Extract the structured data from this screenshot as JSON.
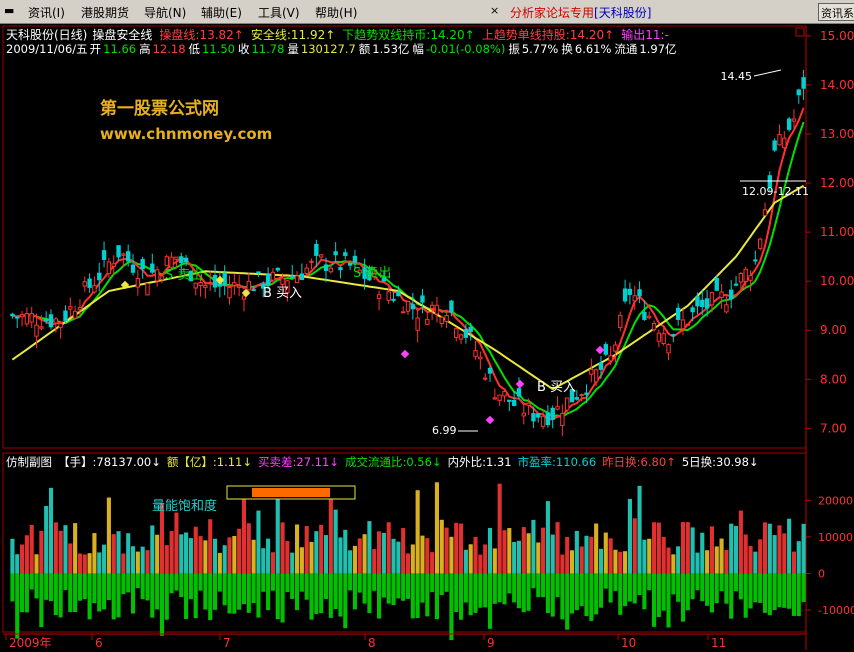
{
  "menu": {
    "items": [
      "资讯(I)",
      "港股期货",
      "导航(N)",
      "辅助(E)",
      "工具(V)",
      "帮助(H)"
    ],
    "ad_prefix": "分析家论坛专用",
    "ad_name": "[天科股份]",
    "right_button": "资讯系统",
    "min_icon": "minimize-icon",
    "close_icon": "close-icon"
  },
  "colors": {
    "up": "#ff3030",
    "down": "#00d0d0",
    "ma": "#e8e840",
    "vol_up": "#e03030",
    "vol_down": "#20c0b0"
  },
  "main": {
    "title": "天科股份(日线)",
    "indicator_name": "操盘安全线",
    "indicators": [
      {
        "label": "操盘线:",
        "value": "13.82",
        "arrow": "↑",
        "color": "#ff4040"
      },
      {
        "label": "安全线:",
        "value": "11.92",
        "arrow": "↑",
        "color": "#e8e840"
      },
      {
        "label": "下趋势双线持币:",
        "value": "14.20",
        "arrow": "↑",
        "color": "#00e000"
      },
      {
        "label": "上趋势单线持股:",
        "value": "14.20",
        "arrow": "↑",
        "color": "#ff4040"
      },
      {
        "label": "输出11:",
        "value": "-",
        "arrow": "",
        "color": "#ff40ff"
      }
    ],
    "quote": {
      "date": "2009/11/06/五",
      "items": [
        {
          "label": "开",
          "value": "11.66",
          "color": "#00e000"
        },
        {
          "label": "高",
          "value": "12.18",
          "color": "#ff4040"
        },
        {
          "label": "低",
          "value": "11.50",
          "color": "#00e000"
        },
        {
          "label": "收",
          "value": "11.78",
          "color": "#00e000"
        },
        {
          "label": "量",
          "value": "130127.7",
          "color": "#e8e840"
        },
        {
          "label": "额",
          "value": "1.53亿",
          "color": "#ffffff"
        },
        {
          "label": "幅",
          "value": "-0.01(-0.08%)",
          "color": "#00e000"
        },
        {
          "label": "振",
          "value": "5.77%",
          "color": "#ffffff"
        },
        {
          "label": "换",
          "value": "6.61%",
          "color": "#ffffff"
        },
        {
          "label": "流通",
          "value": "1.97亿",
          "color": "#ffffff"
        }
      ]
    },
    "watermark_cn": "第一股票公式网",
    "watermark_url": "www.chnmoney.com",
    "annotations": {
      "high": "14.45",
      "low": "6.99",
      "range": "12.09-12.11",
      "sell1": "S 卖出",
      "buy1": "B 买入",
      "sell2": "S 卖出",
      "buy2": "B 买入"
    },
    "price_axis": {
      "min": 6.6,
      "max": 15.2,
      "ticks": [
        "15.00",
        "14.00",
        "13.00",
        "12.00",
        "11.00",
        "10.00",
        "9.00",
        "8.00",
        "7.00"
      ]
    }
  },
  "sub": {
    "title": "仿制副图",
    "stats": [
      {
        "label": "【手】:",
        "value": "78137.00",
        "arrow": "↓",
        "color": "#ffffff"
      },
      {
        "label": "额【亿】:",
        "value": "1.11",
        "arrow": "↓",
        "color": "#e8e840"
      },
      {
        "label": "买卖差:",
        "value": "27.11",
        "arrow": "↓",
        "color": "#ff40ff"
      },
      {
        "label": "成交流通比:",
        "value": "0.56",
        "arrow": "↓",
        "color": "#00e000"
      },
      {
        "label": "内外比:",
        "value": "1.31",
        "arrow": "",
        "color": "#ffffff"
      },
      {
        "label": "市盈率:",
        "value": "110.66",
        "arrow": "",
        "color": "#00d0d0"
      },
      {
        "label": "昨日换:",
        "value": "6.80",
        "arrow": "↑",
        "color": "#ff4040"
      },
      {
        "label": "5日换:",
        "value": "30.98",
        "arrow": "↓",
        "color": "#ffffff"
      }
    ],
    "saturation_label": "量能饱和度",
    "axis": {
      "min": -16000,
      "max": 28000,
      "ticks": [
        "20000",
        "10000",
        "0",
        "-10000"
      ]
    }
  },
  "time_axis": [
    "2009年",
    "6",
    "7",
    "8",
    "9",
    "10",
    "11"
  ],
  "chart_data": {
    "type": "candlestick",
    "days": 165,
    "anchors": [
      [
        0,
        9.3
      ],
      [
        10,
        9.2
      ],
      [
        22,
        10.6
      ],
      [
        28,
        10.1
      ],
      [
        34,
        10.5
      ],
      [
        40,
        9.9
      ],
      [
        48,
        9.9
      ],
      [
        52,
        10.0
      ],
      [
        58,
        10.1
      ],
      [
        64,
        10.4
      ],
      [
        70,
        10.3
      ],
      [
        78,
        9.8
      ],
      [
        84,
        9.4
      ],
      [
        90,
        9.5
      ],
      [
        95,
        8.8
      ],
      [
        100,
        7.8
      ],
      [
        104,
        7.5
      ],
      [
        108,
        7.3
      ],
      [
        112,
        7.3
      ],
      [
        118,
        7.8
      ],
      [
        124,
        8.4
      ],
      [
        128,
        9.8
      ],
      [
        132,
        9.3
      ],
      [
        136,
        8.9
      ],
      [
        142,
        9.4
      ],
      [
        148,
        9.7
      ],
      [
        154,
        10.4
      ],
      [
        158,
        12.6
      ],
      [
        162,
        13.3
      ],
      [
        165,
        14.4
      ]
    ],
    "ma_anchors": [
      [
        0,
        8.4
      ],
      [
        20,
        9.8
      ],
      [
        40,
        10.2
      ],
      [
        60,
        10.1
      ],
      [
        80,
        9.8
      ],
      [
        100,
        8.6
      ],
      [
        112,
        7.8
      ],
      [
        125,
        8.5
      ],
      [
        140,
        9.5
      ],
      [
        150,
        10.5
      ],
      [
        158,
        11.6
      ],
      [
        165,
        12.0
      ]
    ],
    "volume_scale": 20000
  }
}
